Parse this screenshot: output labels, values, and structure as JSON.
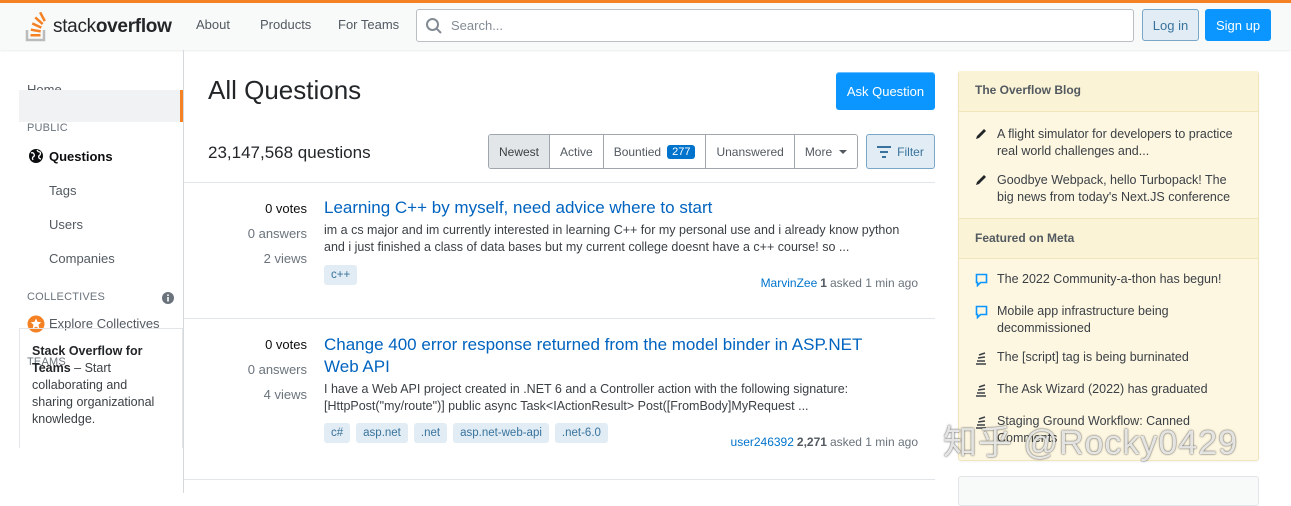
{
  "topbar": {
    "logo_light": "stack",
    "logo_bold": "overflow",
    "nav": [
      "About",
      "Products",
      "For Teams"
    ],
    "search_placeholder": "Search...",
    "login_label": "Log in",
    "signup_label": "Sign up"
  },
  "leftnav": {
    "home": "Home",
    "public_heading": "PUBLIC",
    "questions": "Questions",
    "tags": "Tags",
    "users": "Users",
    "companies": "Companies",
    "collectives_heading": "COLLECTIVES",
    "explore_collectives": "Explore Collectives",
    "teams_heading": "TEAMS",
    "teams_title": "Stack Overflow for Teams",
    "teams_text": " – Start collaborating and sharing organizational knowledge."
  },
  "main": {
    "title": "All Questions",
    "ask_label": "Ask Question",
    "count": "23,147,568 questions",
    "tabs": [
      {
        "label": "Newest",
        "selected": true
      },
      {
        "label": "Active"
      },
      {
        "label": "Bountied",
        "badge": "277"
      },
      {
        "label": "Unanswered"
      },
      {
        "label": "More"
      }
    ],
    "filter_label": "Filter",
    "questions": [
      {
        "votes": "0 votes",
        "answers": "0 answers",
        "views": "2 views",
        "title": "Learning C++ by myself, need advice where to start",
        "excerpt": "im a cs major and im currently interested in learning C++ for my personal use and i already know python and i just finished a class of data bases but my current college doesnt have a c++ course! so ...",
        "tags": [
          "c++"
        ],
        "user": "MarvinZee",
        "rep": "1",
        "asked": "asked 1 min ago"
      },
      {
        "votes": "0 votes",
        "answers": "0 answers",
        "views": "4 views",
        "title": "Change 400 error response returned from the model binder in ASP.NET Web API",
        "excerpt": "I have a Web API project created in .NET 6 and a Controller action with the following signature: [HttpPost(\"my/route\")] public async Task<IActionResult> Post([FromBody]MyRequest ...",
        "tags": [
          "c#",
          "asp.net",
          ".net",
          "asp.net-web-api",
          ".net-6.0"
        ],
        "user": "user246392",
        "rep": "2,271",
        "asked": "asked 1 min ago"
      }
    ]
  },
  "sidebar": {
    "blog_heading": "The Overflow Blog",
    "blog_items": [
      "A flight simulator for developers to practice real world challenges and...",
      "Goodbye Webpack, hello Turbopack! The big news from today's Next.JS conference"
    ],
    "meta_heading": "Featured on Meta",
    "meta_items": [
      "The 2022 Community-a-thon has begun!",
      "Mobile app infrastructure being decommissioned",
      "The [script] tag is being burninated",
      "The Ask Wizard (2022) has graduated",
      "Staging Ground Workflow: Canned Comments"
    ]
  },
  "watermark": "知乎 @Rocky0429",
  "colors": {
    "accent": "#f48225",
    "primary_button": "#0a95ff",
    "link": "#0063bf",
    "blog_bg": "#fdf7e2"
  }
}
